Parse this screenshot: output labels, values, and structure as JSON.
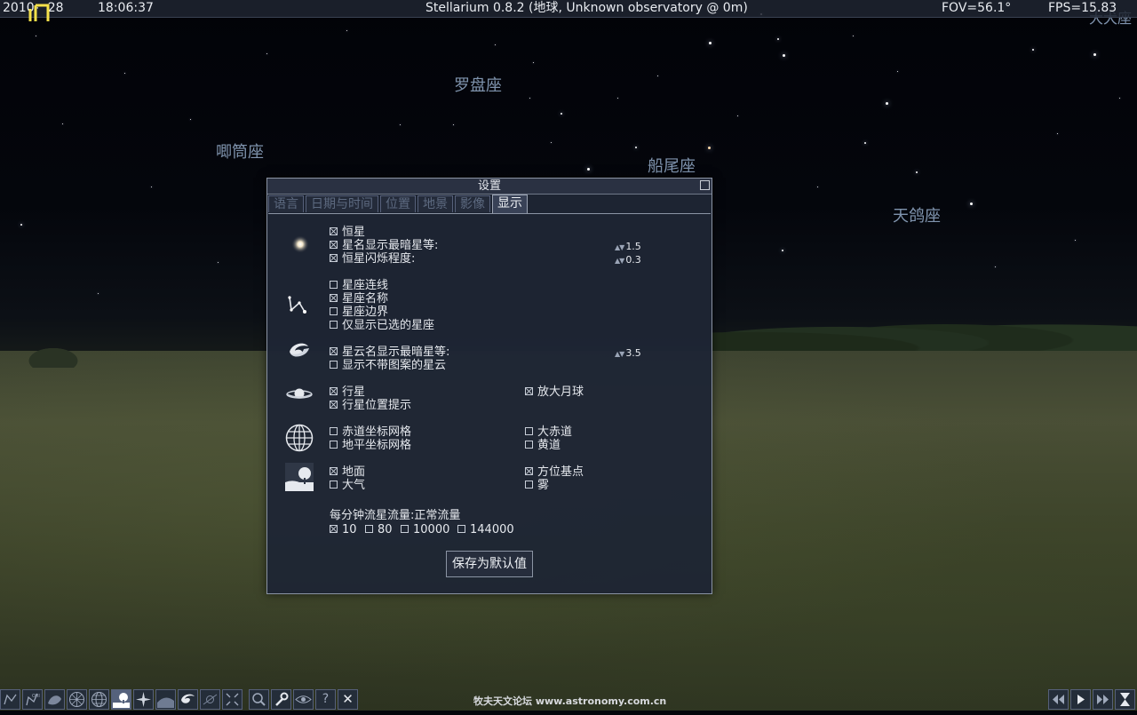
{
  "topbar": {
    "date": "2010-",
    "date_tail": "28",
    "time": "18:06:37",
    "title": "Stellarium 0.8.2 (地球, Unknown observatory @ 0m)",
    "fov": "FOV=56.1°",
    "fps": "FPS=15.83",
    "corner_label": "大犬座"
  },
  "sky": {
    "constellations": [
      "罗盘座",
      "唧筒座",
      "船尾座",
      "天鸽座"
    ]
  },
  "dialog": {
    "title": "设置",
    "tabs": [
      "语言",
      "日期与时间",
      "位置",
      "地景",
      "影像",
      "显示"
    ],
    "active_tab": "显示",
    "stars": {
      "show_stars": {
        "label": "恒星",
        "checked": true
      },
      "star_names": {
        "label": "星名显示最暗星等:",
        "checked": true,
        "value": "1.5"
      },
      "twinkle": {
        "label": "恒星闪烁程度:",
        "checked": true,
        "value": "0.3"
      }
    },
    "constellations": {
      "lines": {
        "label": "星座连线",
        "checked": false
      },
      "names": {
        "label": "星座名称",
        "checked": true
      },
      "boundaries": {
        "label": "星座边界",
        "checked": false
      },
      "selected_only": {
        "label": "仅显示已选的星座",
        "checked": false
      }
    },
    "nebulae": {
      "names": {
        "label": "星云名显示最暗星等:",
        "checked": true,
        "value": "3.5"
      },
      "no_texture": {
        "label": "显示不带图案的星云",
        "checked": false
      }
    },
    "planets": {
      "planets": {
        "label": "行星",
        "checked": true
      },
      "hints": {
        "label": "行星位置提示",
        "checked": true
      },
      "moon_scale": {
        "label": "放大月球",
        "checked": true
      }
    },
    "grids": {
      "equatorial": {
        "label": "赤道坐标网格",
        "checked": false
      },
      "azimuthal": {
        "label": "地平坐标网格",
        "checked": false
      },
      "equator": {
        "label": "大赤道",
        "checked": false
      },
      "ecliptic": {
        "label": "黄道",
        "checked": false
      }
    },
    "landscape": {
      "ground": {
        "label": "地面",
        "checked": true
      },
      "atmosphere": {
        "label": "大气",
        "checked": false
      },
      "cardinal": {
        "label": "方位基点",
        "checked": true
      },
      "fog": {
        "label": "雾",
        "checked": false
      }
    },
    "meteors": {
      "title": "每分钟流星流量:正常流量",
      "options": [
        {
          "label": "10",
          "checked": true
        },
        {
          "label": "80",
          "checked": false
        },
        {
          "label": "10000",
          "checked": false
        },
        {
          "label": "144000",
          "checked": false
        }
      ]
    },
    "save_button": "保存为默认值"
  },
  "bottombar": {
    "help": "?",
    "close": "✕",
    "watermark": "牧夫天文论坛 www.astronomy.com.cn"
  },
  "colors": {
    "dialog_bg": "#1e2534",
    "constellation_label": "#7f93ad",
    "accent_logo": "#f5e14a"
  }
}
